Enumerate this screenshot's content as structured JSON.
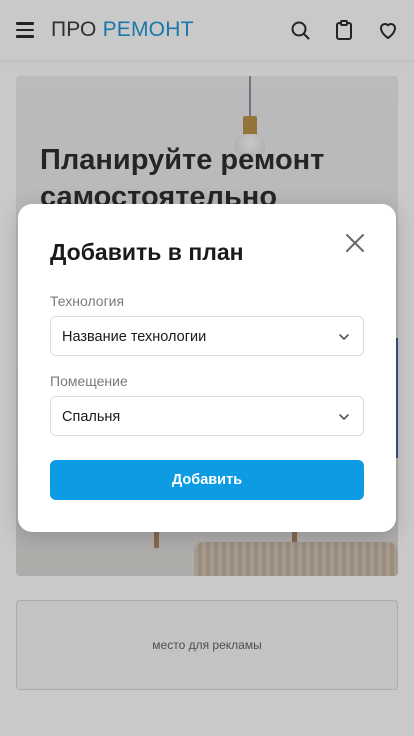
{
  "header": {
    "logo_part1": "ПРО",
    "logo_part2": "РЕМОНТ",
    "icons": [
      "menu-icon",
      "search-icon",
      "clipboard-icon",
      "heart-icon"
    ]
  },
  "hero": {
    "title": "Планируйте ремонт самостоятельно"
  },
  "ad": {
    "text": "место для рекламы"
  },
  "modal": {
    "title": "Добавить в план",
    "fields": [
      {
        "label": "Технология",
        "value": "Название технологии"
      },
      {
        "label": "Помещение",
        "value": "Спальня"
      }
    ],
    "submit_label": "Добавить"
  },
  "colors": {
    "accent": "#0d9be3",
    "brand": "#0e8fd6"
  }
}
